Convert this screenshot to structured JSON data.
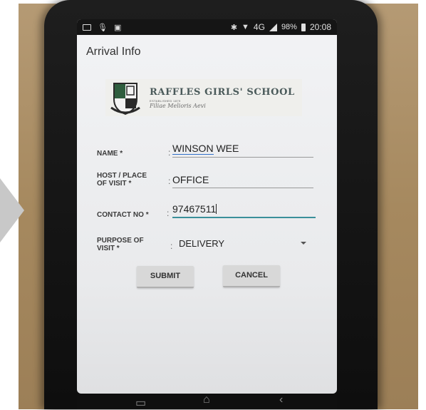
{
  "status_bar": {
    "signal_text": "4G",
    "battery_percent": "98%",
    "time": "20:08",
    "icons": [
      "image-icon",
      "microphone-icon",
      "sim-icon",
      "bluetooth-icon",
      "data-arrows-icon",
      "signal-icon",
      "battery-icon"
    ]
  },
  "app": {
    "title": "Arrival Info"
  },
  "logo": {
    "school_name": "RAFFLES GIRLS' SCHOOL",
    "established": "ESTABLISHED 1879",
    "motto": "Filiae Melioris Aevi"
  },
  "form": {
    "name_label": "NAME *",
    "name_first": "WINSON",
    "name_rest": " WEE",
    "host_label_line1": "HOST / PLACE",
    "host_label_line2": "OF VISIT *",
    "host_value": "OFFICE",
    "contact_label": "CONTACT NO *",
    "contact_value": "97467511",
    "purpose_label_line1": "PURPOSE OF",
    "purpose_label_line2": "VISIT *",
    "purpose_value": "DELIVERY",
    "colon": ":"
  },
  "buttons": {
    "submit": "SUBMIT",
    "cancel": "CANCEL"
  },
  "colors": {
    "accent": "#3a8f9a",
    "screen_bg": "#ecedef",
    "status_bar": "#151515"
  }
}
